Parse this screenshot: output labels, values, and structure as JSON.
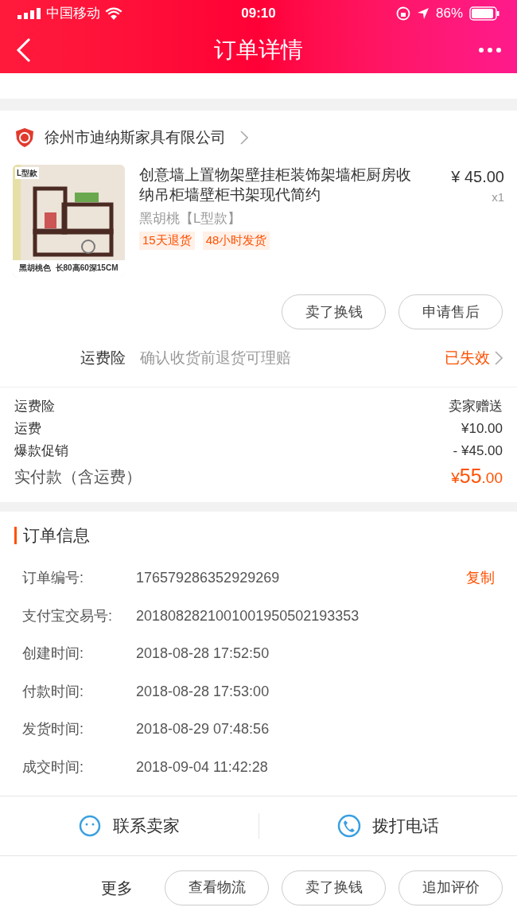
{
  "status_bar": {
    "carrier": "中国移动",
    "time": "09:10",
    "battery": "86%"
  },
  "nav": {
    "title": "订单详情"
  },
  "shop": {
    "name": "徐州市迪纳斯家具有限公司"
  },
  "product": {
    "title": "创意墙上置物架壁挂柜装饰架墙柜厨房收纳吊柜墙壁柜书架现代简约",
    "price": "¥ 45.00",
    "qty": "x1",
    "sku": "黑胡桃【L型款】",
    "tags": [
      "15天退货",
      "48小时发货"
    ],
    "image_tag": "L型款",
    "image_caption": "黑胡桃色  长80高60深15CM"
  },
  "item_buttons": [
    "卖了换钱",
    "申请售后"
  ],
  "insurance": {
    "label": "运费险",
    "desc": "确认收货前退货可理赔",
    "status": "已失效"
  },
  "fees": [
    {
      "label": "运费险",
      "value": "卖家赠送"
    },
    {
      "label": "运费",
      "value": "¥10.00"
    },
    {
      "label": "爆款促销",
      "value": "- ¥45.00"
    }
  ],
  "total": {
    "label": "实付款（含运费）",
    "currency": "¥",
    "integer": "55",
    "decimal": ".00"
  },
  "order_info": {
    "title": "订单信息",
    "copy": "复制",
    "rows": [
      {
        "label": "订单编号:",
        "value": "176579286352929269"
      },
      {
        "label": "支付宝交易号:",
        "value": "2018082821001001950502193353"
      },
      {
        "label": "创建时间:",
        "value": "2018-08-28 17:52:50"
      },
      {
        "label": "付款时间:",
        "value": "2018-08-28 17:53:00"
      },
      {
        "label": "发货时间:",
        "value": "2018-08-29 07:48:56"
      },
      {
        "label": "成交时间:",
        "value": "2018-09-04 11:42:28"
      }
    ]
  },
  "contact": [
    "联系卖家",
    "拨打电话"
  ],
  "footer": {
    "more": "更多",
    "buttons": [
      "查看物流",
      "卖了换钱",
      "追加评价"
    ]
  }
}
